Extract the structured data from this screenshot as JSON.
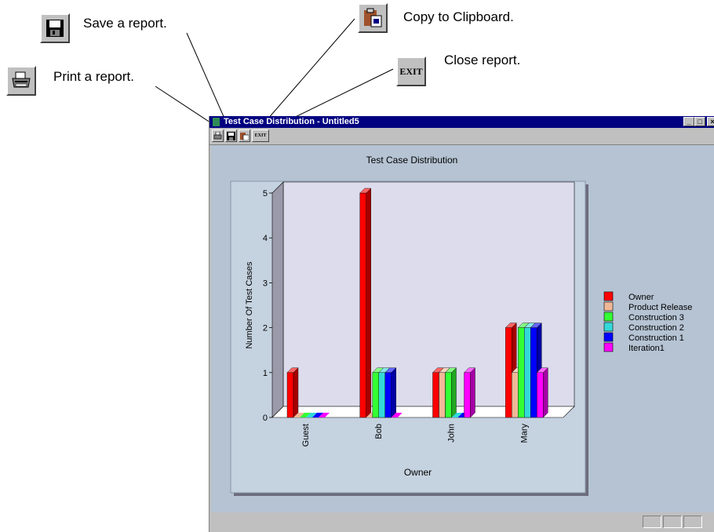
{
  "callouts": {
    "save": "Save a report.",
    "copy": "Copy to Clipboard.",
    "close": "Close report.",
    "print": "Print a report."
  },
  "window": {
    "title": "Test Case Distribution - Untitled5",
    "exit_label": "EXIT",
    "exit_label_small": "EXIT"
  },
  "colors": {
    "titlebar": "#000080",
    "client_bg": "#b5c3d3",
    "plot_panel": "#c5d2e0",
    "plot_face": "#dcdcec"
  },
  "chart_data": {
    "type": "bar",
    "title": "Test Case Distribution",
    "xlabel": "Owner",
    "ylabel": "Number Of Test Cases",
    "categories": [
      "Guest",
      "Bob",
      "John",
      "Mary"
    ],
    "ylim": [
      0,
      5
    ],
    "yticks": [
      "0",
      "1",
      "2",
      "3",
      "4",
      "5"
    ],
    "legend_position": "right",
    "grid": false,
    "series": [
      {
        "name": "Owner",
        "color": "#ff0000",
        "values": [
          1,
          5,
          1,
          2
        ]
      },
      {
        "name": "Product Release",
        "color": "#f0b898",
        "values": [
          0,
          0,
          1,
          1
        ]
      },
      {
        "name": "Construction 3",
        "color": "#33ff33",
        "values": [
          0,
          1,
          1,
          2
        ]
      },
      {
        "name": "Construction 2",
        "color": "#33d9d9",
        "values": [
          0,
          1,
          0,
          2
        ]
      },
      {
        "name": "Construction 1",
        "color": "#0000ff",
        "values": [
          0,
          1,
          0,
          2
        ]
      },
      {
        "name": "Iteration1",
        "color": "#ff00ff",
        "values": [
          0,
          0,
          1,
          1
        ]
      }
    ]
  }
}
